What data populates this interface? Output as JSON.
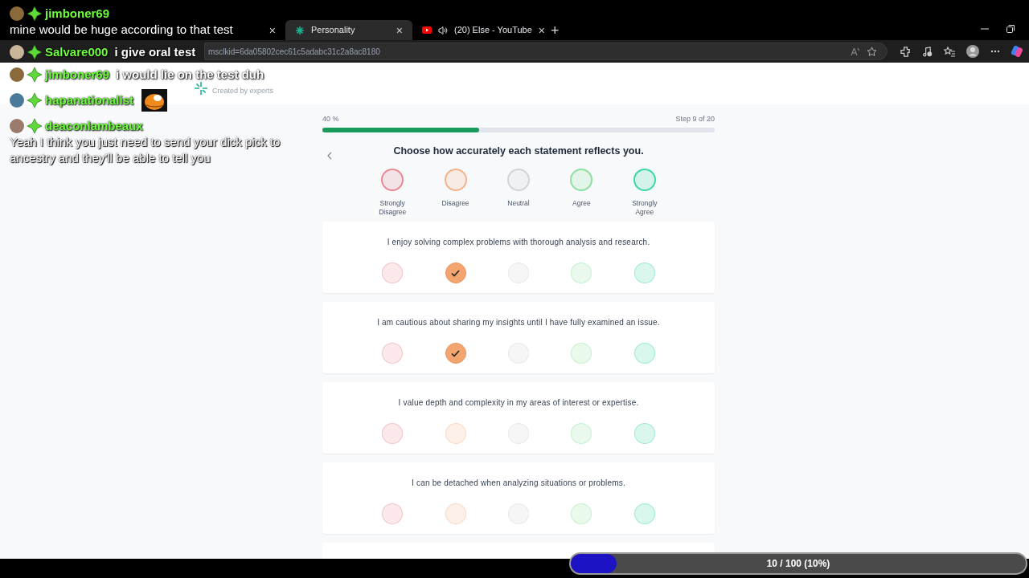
{
  "browser": {
    "tabs": [
      {
        "close": "×",
        "selected": false,
        "kind": "hidden"
      },
      {
        "title": "Personality",
        "close": "×",
        "selected": true,
        "kind": "site"
      },
      {
        "title": "(20) Else - YouTube",
        "close": "×",
        "selected": false,
        "kind": "video"
      }
    ],
    "new_tab": "+",
    "url": "msclkid=6da05802cec61c5adabc31c2a8ac8180"
  },
  "page": {
    "tagline": "Created by experts",
    "progress_label": "40 %",
    "progress": {
      "level": 0.4
    },
    "step": "Step 9 of 20",
    "heading": "Choose how accurately each statement reflects you.",
    "scale": [
      {
        "label": "Strongly Disagree",
        "color": "#e88a95"
      },
      {
        "label": "Disagree",
        "color": "#f3b48c"
      },
      {
        "label": "Neutral",
        "color": "#d4d4d8"
      },
      {
        "label": "Agree",
        "color": "#8fe0a0"
      },
      {
        "label": "Strongly Agree",
        "color": "#3fd7a5"
      }
    ],
    "statements": [
      {
        "text": "I enjoy solving complex problems with thorough analysis and research.",
        "answers": [
          {
            "selected": false
          },
          {
            "selected": true
          },
          {
            "selected": false
          },
          {
            "selected": false
          },
          {
            "selected": false
          }
        ]
      },
      {
        "text": "I am cautious about sharing my insights until I have fully examined an issue.",
        "answers": [
          {
            "selected": false
          },
          {
            "selected": true
          },
          {
            "selected": false
          },
          {
            "selected": false
          },
          {
            "selected": false
          }
        ]
      },
      {
        "text": "I value depth and complexity in my areas of interest or expertise.",
        "answers": [
          {
            "selected": false
          },
          {
            "selected": false
          },
          {
            "selected": false
          },
          {
            "selected": false
          },
          {
            "selected": false
          }
        ]
      },
      {
        "text": "I can be detached when analyzing situations or problems.",
        "answers": [
          {
            "selected": false
          },
          {
            "selected": false
          },
          {
            "selected": false
          },
          {
            "selected": false
          },
          {
            "selected": false
          }
        ]
      }
    ]
  },
  "chat": [
    {
      "user": "jimboner69",
      "text": "mine would be huge according to that test",
      "kind": "block"
    },
    {
      "user": "Salvare000",
      "text": "i give oral test",
      "kind": "inline"
    },
    {
      "user": "jimboner69",
      "text": "i would lie on the test duh",
      "kind": "inline"
    },
    {
      "user": "hapanationalist",
      "kind": "emote"
    },
    {
      "user": "deaconlambeaux",
      "text": "Yeah I think you just need to send your dick pick to ancestry and they'll be able to tell you",
      "kind": "block"
    }
  ],
  "goal": {
    "label": "10 / 100 (10%)",
    "level": 0.1
  }
}
